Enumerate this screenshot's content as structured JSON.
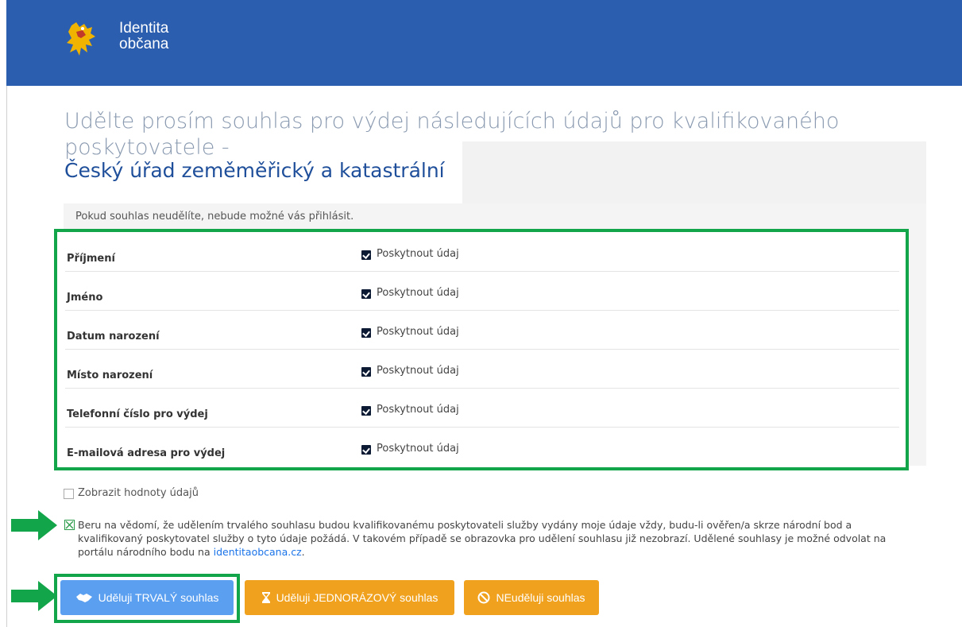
{
  "header": {
    "brand_line1": "Identita",
    "brand_line2": "občana",
    "background": "#2b5eae"
  },
  "page": {
    "title_prefix": "Udělte prosím souhlas pro výdej následujících údajů pro kvalifikovaného poskytovatele -",
    "provider_name": "Český úřad zeměměřický a katastrální",
    "notice": "Pokud souhlas neudělíte, nebude možné vás přihlásit."
  },
  "attributes": [
    {
      "label": "Příjmení",
      "checkbox_label": "Poskytnout údaj",
      "checked": true
    },
    {
      "label": "Jméno",
      "checkbox_label": "Poskytnout údaj",
      "checked": true
    },
    {
      "label": "Datum narození",
      "checkbox_label": "Poskytnout údaj",
      "checked": true
    },
    {
      "label": "Místo narození",
      "checkbox_label": "Poskytnout údaj",
      "checked": true
    },
    {
      "label": "Telefonní číslo pro výdej",
      "checkbox_label": "Poskytnout údaj",
      "checked": true
    },
    {
      "label": "E-mailová adresa pro výdej",
      "checkbox_label": "Poskytnout údaj",
      "checked": true
    }
  ],
  "show_values": {
    "label": "Zobrazit hodnoty údajů",
    "checked": false
  },
  "permanent_consent": {
    "checked": true,
    "text": "Beru na vědomí, že udělením trvalého souhlasu budou kvalifikovanému poskytovateli služby vydány moje údaje vždy, budu-li ověřen/a skrze národní bod a kvalifikovaný poskytovatel služby o tyto údaje požádá. V takovém případě se obrazovka pro udělení souhlasu již nezobrazí. Udělené souhlasy je možné odvolat na portálu národního bodu na",
    "link": "identitaobcana.cz",
    "suffix": "."
  },
  "buttons": {
    "permanent": {
      "label": "Uděluji TRVALÝ souhlas",
      "icon": "handshake-icon",
      "color": "#5b9ff0"
    },
    "one_time": {
      "label": "Uděluji JEDNORÁZOVÝ souhlas",
      "icon": "hourglass-icon",
      "color": "#f0a21e"
    },
    "deny": {
      "label": "NEuděluji souhlas",
      "icon": "ban-icon",
      "color": "#f0a21e"
    }
  },
  "highlight_color": "#13a54a"
}
